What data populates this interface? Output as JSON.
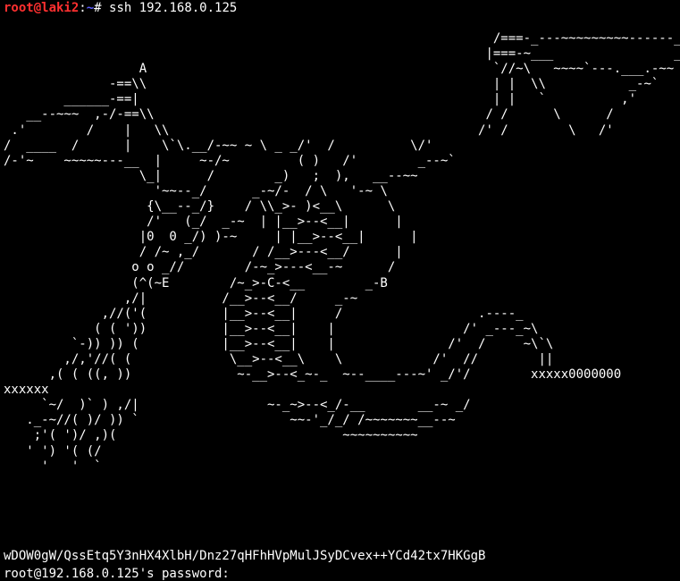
{
  "prompt": {
    "user_host": "root@laki2",
    "separator": ":",
    "path": "~",
    "symbol": "#",
    "command": " ssh 192.168.0.125"
  },
  "banner": {
    "lines": [
      "                                                                 /===-_---~~~~~~~~~------____",
      "                                                                |===-~___                _,-'S",
      "                  A                                              `//~\\   ~~~~`---.___.-~~",
      "              -==\\\\                                              | |  \\\\           _-~`",
      "        ______-==|                                               | |   `          ,'",
      "   __--~~~  ,-/-==\\\\                                            / /      \\      /",
      " .'        /    |   \\\\                                         /' /        \\   /'",
      "/  ____  /      |    \\`\\.__/-~~ ~ \\ _ _/'  /          \\/'",
      "/-'~    ~~~~~---__  |     ~-/~         ( )   /'        _--~`",
      "                  \\_|      /        _)   ;  ),   __--~~",
      "                    '~~--_/      _-~/-  / \\   '-~ \\",
      "                   {\\__--_/}    / \\\\_>- )<__\\      \\",
      "                   /'   (_/  _-~  | |__>--<__|      |",
      "                  |0  0 _/) )-~     | |__>--<__|      |",
      "                  / /~ ,_/       / /__>---<__/      |",
      "                 o o _//        /-~_>---<__-~      /",
      "                 (^(~E        /~_>-C-<__        _-B",
      "                ,/|          /__>--<__/     _-~",
      "             ,//('(          |__>--<__|     /                  .----_",
      "            ( ( '))          |__>--<__|    |                 /' _---_~\\",
      "         `-)) )) (           |__>--<__|    |               /'  /     ~\\`\\",
      "        ,/,'//( (             \\__>--<__\\    \\            /'  //        ||",
      "      ,( ( ((, ))              ~-__>--<_~-_  ~--____---~' _/'/        xxxxx0000000",
      "xxxxxx",
      "     `~/  )` ) ,/|                 ~-_~>--<_/-__       __-~ _/",
      "   ._-~//( )/ )) `                    ~~-'_/_/ /~~~~~~~__--~",
      "    ;'( ')/ ,)(                              ~~~~~~~~~~",
      "   ' ') '( (/",
      "     '   '  `"
    ]
  },
  "ssh": {
    "key_line": "wDOW0gW/QssEtq5Y3nHX4XlbH/Dnz27qHFhHVpMulJSyDCvex++YCd42tx7HKGgB",
    "password_prompt": "root@192.168.0.125's password: "
  }
}
